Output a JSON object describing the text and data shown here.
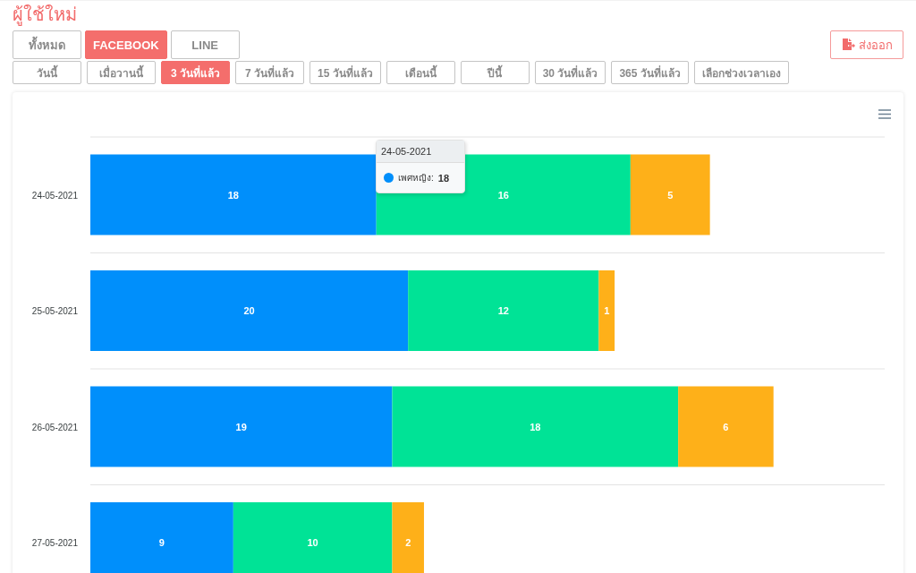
{
  "title": "ผู้ใช้ใหม่",
  "channel_tabs": [
    {
      "label": "ทั้งหมด",
      "selected": false
    },
    {
      "label": "FACEBOOK",
      "selected": true
    },
    {
      "label": "LINE",
      "selected": false
    }
  ],
  "export_button": {
    "label": "ส่งออก"
  },
  "range_tabs": [
    {
      "label": "วันนี้",
      "selected": false
    },
    {
      "label": "เมื่อวานนี้",
      "selected": false
    },
    {
      "label": "3 วันที่แล้ว",
      "selected": true
    },
    {
      "label": "7 วันที่แล้ว",
      "selected": false
    },
    {
      "label": "15 วันที่แล้ว",
      "selected": false
    },
    {
      "label": "เดือนนี้",
      "selected": false
    },
    {
      "label": "ปีนี้",
      "selected": false
    },
    {
      "label": "30 วันที่แล้ว",
      "selected": false
    },
    {
      "label": "365 วันที่แล้ว",
      "selected": false
    },
    {
      "label": "เลือกช่วงเวลาเอง",
      "selected": false
    }
  ],
  "chart": {
    "chart_data": {
      "type": "bar",
      "orientation": "horizontal",
      "stacked": true,
      "data_labels": true,
      "xlim": [
        0,
        50
      ],
      "categories": [
        "24-05-2021",
        "25-05-2021",
        "26-05-2021",
        "27-05-2021"
      ],
      "series": [
        {
          "color": "#008ffb",
          "values": [
            18,
            20,
            19,
            9
          ]
        },
        {
          "color": "#00e396",
          "values": [
            16,
            12,
            18,
            10
          ]
        },
        {
          "color": "#feb019",
          "values": [
            5,
            1,
            6,
            2
          ]
        }
      ]
    },
    "tooltip": {
      "title": "24-05-2021",
      "label": "เพศหญิง:",
      "value": "18",
      "color": "#008ffb"
    }
  }
}
